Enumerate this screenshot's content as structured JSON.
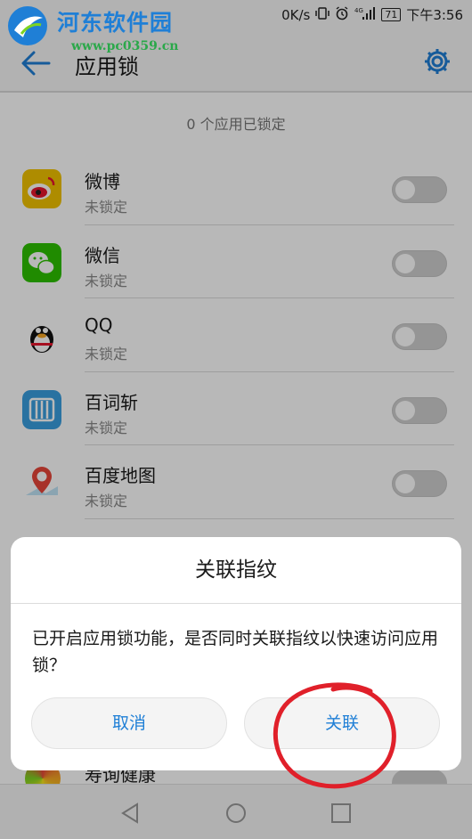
{
  "watermark": {
    "name": "河东软件园",
    "url": "www.pc0359.cn"
  },
  "status_bar": {
    "speed": "0K/s",
    "signal_label": "4G",
    "battery": "71",
    "time": "下午3:56"
  },
  "app_bar": {
    "title": "应用锁"
  },
  "summary": "0 个应用已锁定",
  "apps": [
    {
      "name": "微博",
      "status": "未锁定",
      "icon": "weibo-icon",
      "locked": false
    },
    {
      "name": "微信",
      "status": "未锁定",
      "icon": "wechat-icon",
      "locked": false
    },
    {
      "name": "QQ",
      "status": "未锁定",
      "icon": "qq-icon",
      "locked": false
    },
    {
      "name": "百词斩",
      "status": "未锁定",
      "icon": "baicizhan-icon",
      "locked": false
    },
    {
      "name": "百度地图",
      "status": "未锁定",
      "icon": "baidu-map-icon",
      "locked": false
    }
  ],
  "partial_app": {
    "name": "寿询健康"
  },
  "dialog": {
    "title": "关联指纹",
    "message": "已开启应用锁功能，是否同时关联指纹以快速访问应用锁？",
    "cancel_label": "取消",
    "confirm_label": "关联"
  },
  "colors": {
    "accent": "#1f7fd6",
    "annotation": "#e0202a",
    "toggle_off": "#cfcfcf"
  }
}
